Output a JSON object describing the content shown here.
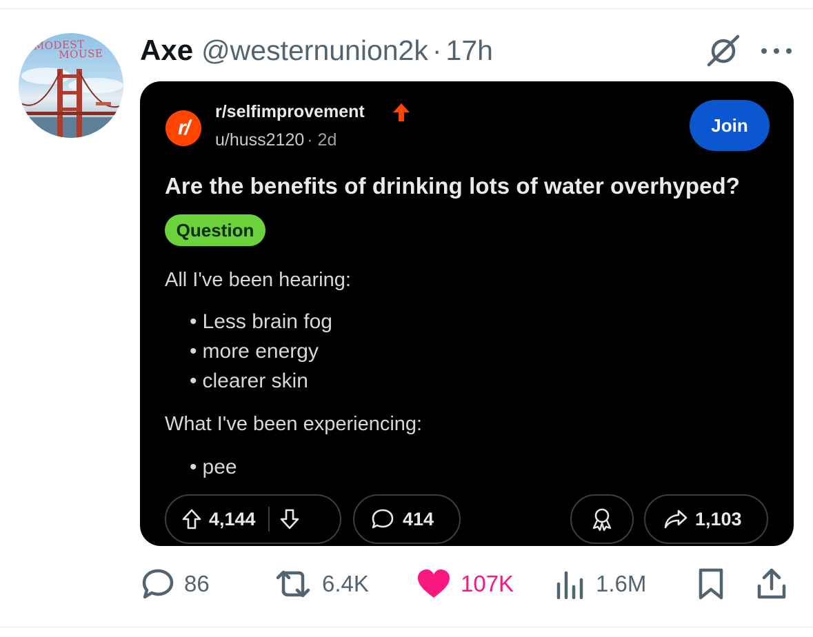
{
  "tweet": {
    "avatar_text": [
      "MODEST",
      "MOUSE"
    ],
    "display_name": "Axe",
    "handle": "@westernunion2k",
    "separator": "·",
    "time": "17h",
    "icons": {
      "grok": "grok-icon",
      "more": "more-dots-icon"
    }
  },
  "reddit_post": {
    "logo_text": "r/",
    "subreddit": "r/selfimprovement",
    "username": "u/huss2120",
    "age": "· 2d",
    "join_label": "Join",
    "title": "Are the benefits of drinking lots of water overhyped?",
    "flair": "Question",
    "flair_color": "#6bd23a",
    "join_color": "#0b57d0",
    "intro": "All I've been hearing:",
    "hearing_items": [
      "Less brain fog",
      "more energy",
      "clearer skin"
    ],
    "experience_intro": "What I've been experiencing:",
    "experience_items": [
      "pee"
    ],
    "upvotes": "4,144",
    "comments": "414",
    "shares": "1,103"
  },
  "actions": {
    "replies": "86",
    "reposts": "6.4K",
    "likes": "107K",
    "views": "1.6M",
    "like_color": "#f91880",
    "icon_color": "#536471"
  }
}
